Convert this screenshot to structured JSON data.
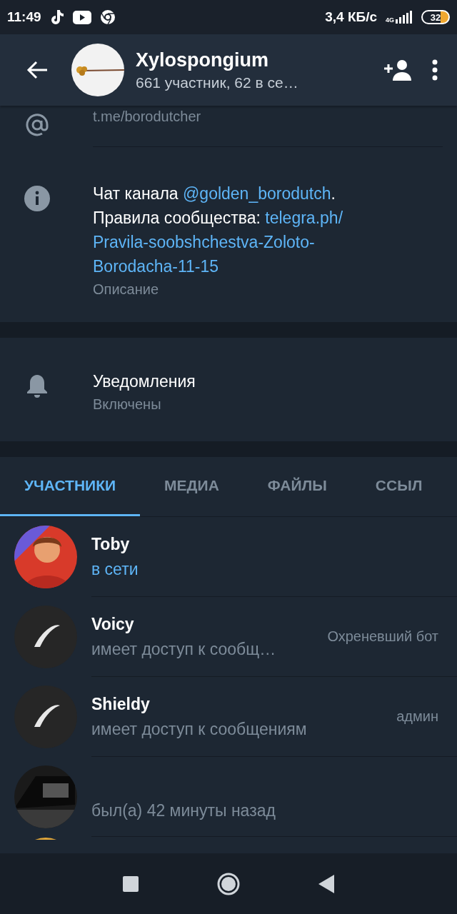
{
  "status_bar": {
    "time": "11:49",
    "speed": "3,4 КБ/с",
    "network": "4G",
    "battery": "32"
  },
  "header": {
    "title": "Xylospongium",
    "subtitle": "661 участник, 62 в се…"
  },
  "info": [
    {
      "kind": "username",
      "caption": "t.me/borodutcher"
    },
    {
      "kind": "description",
      "lines": [
        [
          {
            "kind": "text",
            "text": "Чат канала "
          },
          {
            "kind": "link",
            "text": "@golden_borodutch"
          },
          {
            "kind": "text",
            "text": "."
          }
        ],
        [
          {
            "kind": "text",
            "text": "Правила сообщества: "
          },
          {
            "kind": "link",
            "text": "telegra.ph/"
          }
        ],
        [
          {
            "kind": "link",
            "text": "Pravila-soobshchestva-Zoloto-"
          }
        ],
        [
          {
            "kind": "link",
            "text": "Borodacha-11-15"
          }
        ]
      ],
      "caption": "Описание"
    }
  ],
  "notifications": {
    "title": "Уведомления",
    "caption": "Включены"
  },
  "tabs": [
    {
      "label": "УЧАСТНИКИ",
      "selected": true
    },
    {
      "label": "МЕДИА",
      "selected": false
    },
    {
      "label": "ФАЙЛЫ",
      "selected": false
    },
    {
      "label": "ССЫЛ",
      "selected": false
    }
  ],
  "members": [
    {
      "name": "Toby",
      "status": "в сети",
      "online": true
    },
    {
      "name": "Voicy",
      "status": "имеет доступ к сообщ…",
      "online": false,
      "role": "Охреневший бот"
    },
    {
      "name": "Shieldy",
      "status": "имеет доступ к сообщениям",
      "online": false,
      "role": "админ"
    },
    {
      "status": "был(а) 42 минуты назад",
      "online": false
    }
  ]
}
